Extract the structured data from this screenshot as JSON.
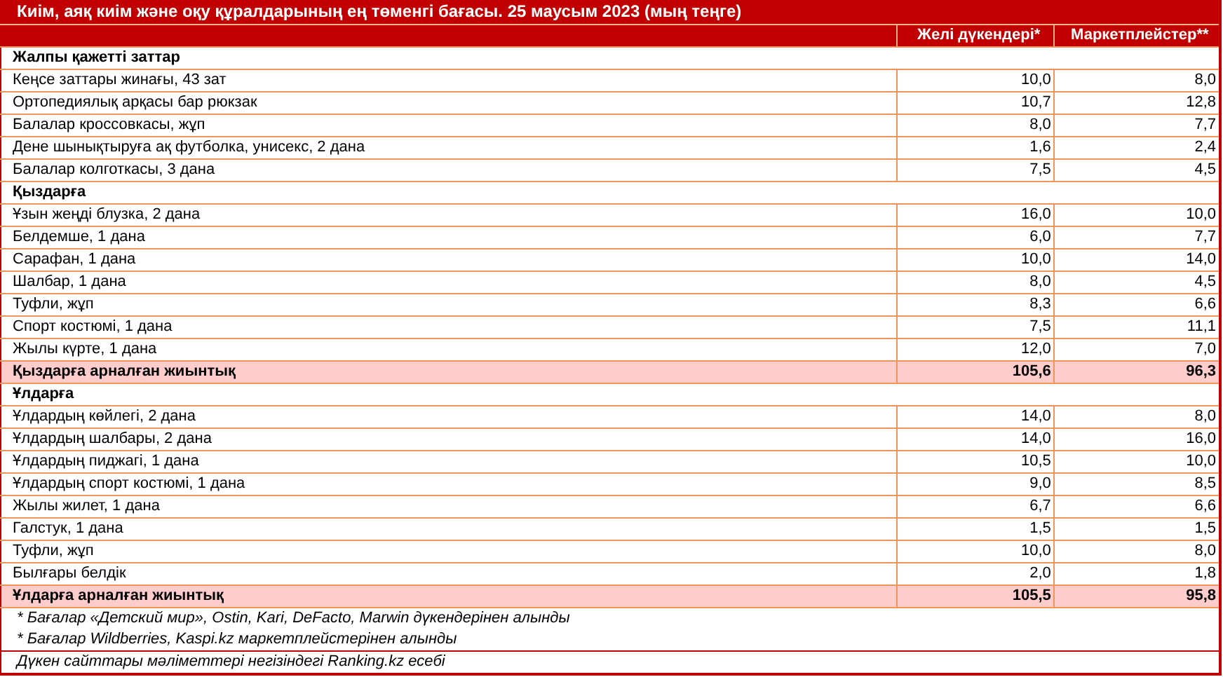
{
  "title": "Киім, аяқ киім және оқу құралдарының ең төменгі бағасы. 25 маусым 2023 (мың теңге)",
  "table": {
    "columns": [
      "Желі дүкендері*",
      "Маркетплейстер**"
    ],
    "rows": [
      {
        "kind": "section",
        "label": "Жалпы қажетті заттар"
      },
      {
        "kind": "item",
        "label": "Кеңсе заттары жинағы, 43 зат",
        "values": [
          "10,0",
          "8,0"
        ]
      },
      {
        "kind": "item",
        "label": "Ортопедиялық арқасы бар рюкзак",
        "values": [
          "10,7",
          "12,8"
        ]
      },
      {
        "kind": "item",
        "label": "Балалар кроссовкасы, жұп",
        "values": [
          "8,0",
          "7,7"
        ]
      },
      {
        "kind": "item",
        "label": "Дене шынықтыруға ақ футболка, унисекс, 2 дана",
        "values": [
          "1,6",
          "2,4"
        ]
      },
      {
        "kind": "item",
        "label": "Балалар колготкасы, 3 дана",
        "values": [
          "7,5",
          "4,5"
        ]
      },
      {
        "kind": "section",
        "label": "Қыздарға"
      },
      {
        "kind": "item",
        "label": "Ұзын жеңді блузка, 2 дана",
        "values": [
          "16,0",
          "10,0"
        ]
      },
      {
        "kind": "item",
        "label": "Белдемше, 1 дана",
        "values": [
          "6,0",
          "7,7"
        ]
      },
      {
        "kind": "item",
        "label": "Сарафан, 1 дана",
        "values": [
          "10,0",
          "14,0"
        ]
      },
      {
        "kind": "item",
        "label": "Шалбар, 1 дана",
        "values": [
          "8,0",
          "4,5"
        ]
      },
      {
        "kind": "item",
        "label": "Туфли, жұп",
        "values": [
          "8,3",
          "6,6"
        ]
      },
      {
        "kind": "item",
        "label": "Спорт костюмі, 1 дана",
        "values": [
          "7,5",
          "11,1"
        ]
      },
      {
        "kind": "item",
        "label": "Жылы күрте, 1 дана",
        "values": [
          "12,0",
          "7,0"
        ]
      },
      {
        "kind": "total",
        "label": "Қыздарға арналған жиынтық",
        "values": [
          "105,6",
          "96,3"
        ]
      },
      {
        "kind": "section",
        "label": "Ұлдарға"
      },
      {
        "kind": "item",
        "label": "Ұлдардың көйлегі, 2 дана",
        "values": [
          "14,0",
          "8,0"
        ]
      },
      {
        "kind": "item",
        "label": "Ұлдардың шалбары, 2 дана",
        "values": [
          "14,0",
          "16,0"
        ]
      },
      {
        "kind": "item",
        "label": "Ұлдардың пиджагі, 1 дана",
        "values": [
          "10,5",
          "10,0"
        ]
      },
      {
        "kind": "item",
        "label": "Ұлдардың спорт костюмі, 1 дана",
        "values": [
          "9,0",
          "8,5"
        ]
      },
      {
        "kind": "item",
        "label": "Жылы жилет, 1 дана",
        "values": [
          "6,7",
          "6,6"
        ]
      },
      {
        "kind": "item",
        "label": "Галстук, 1 дана",
        "values": [
          "1,5",
          "1,5"
        ]
      },
      {
        "kind": "item",
        "label": "Туфли, жұп",
        "values": [
          "10,0",
          "8,0"
        ]
      },
      {
        "kind": "item",
        "label": "Былғары белдік",
        "values": [
          "2,0",
          "1,8"
        ]
      },
      {
        "kind": "total",
        "label": "Ұлдарға арналған жиынтық",
        "values": [
          "105,5",
          "95,8"
        ]
      }
    ]
  },
  "footnotes": [
    "* Бағалар «Детский мир», Ostin, Kari, DeFacto, Marwin дүкендерінен алынды",
    "* Бағалар Wildberries, Kaspi.kz маркетплейстерінен алынды"
  ],
  "source": "Дүкен сайттары мәліметтері негізіндегі Ranking.kz есебі"
}
